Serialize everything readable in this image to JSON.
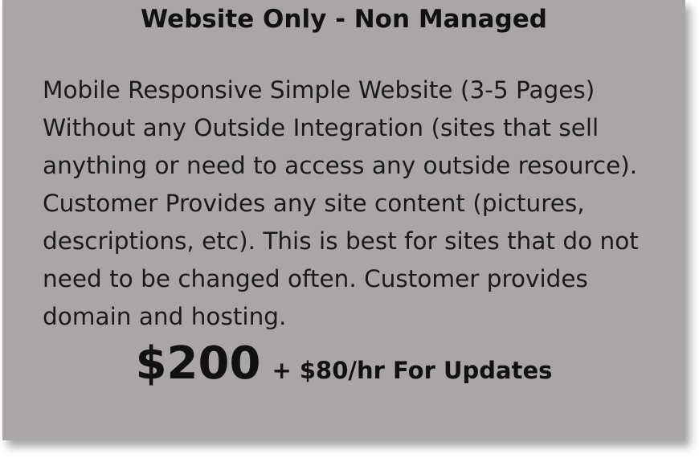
{
  "plan": {
    "title": "Website Only - Non Managed",
    "description": "Mobile Responsive Simple Website (3-5 Pages) Without any Outside Integration (sites that sell anything or need to access any outside resource). Customer Provides any site content (pictures, descriptions, etc). This is best for sites that do not need to be changed often. Customer provides domain and hosting.",
    "price": "$200",
    "price_note": "+ $80/hr For Updates"
  },
  "colors": {
    "card_background": "#a9a6a5",
    "text": "#111111"
  }
}
